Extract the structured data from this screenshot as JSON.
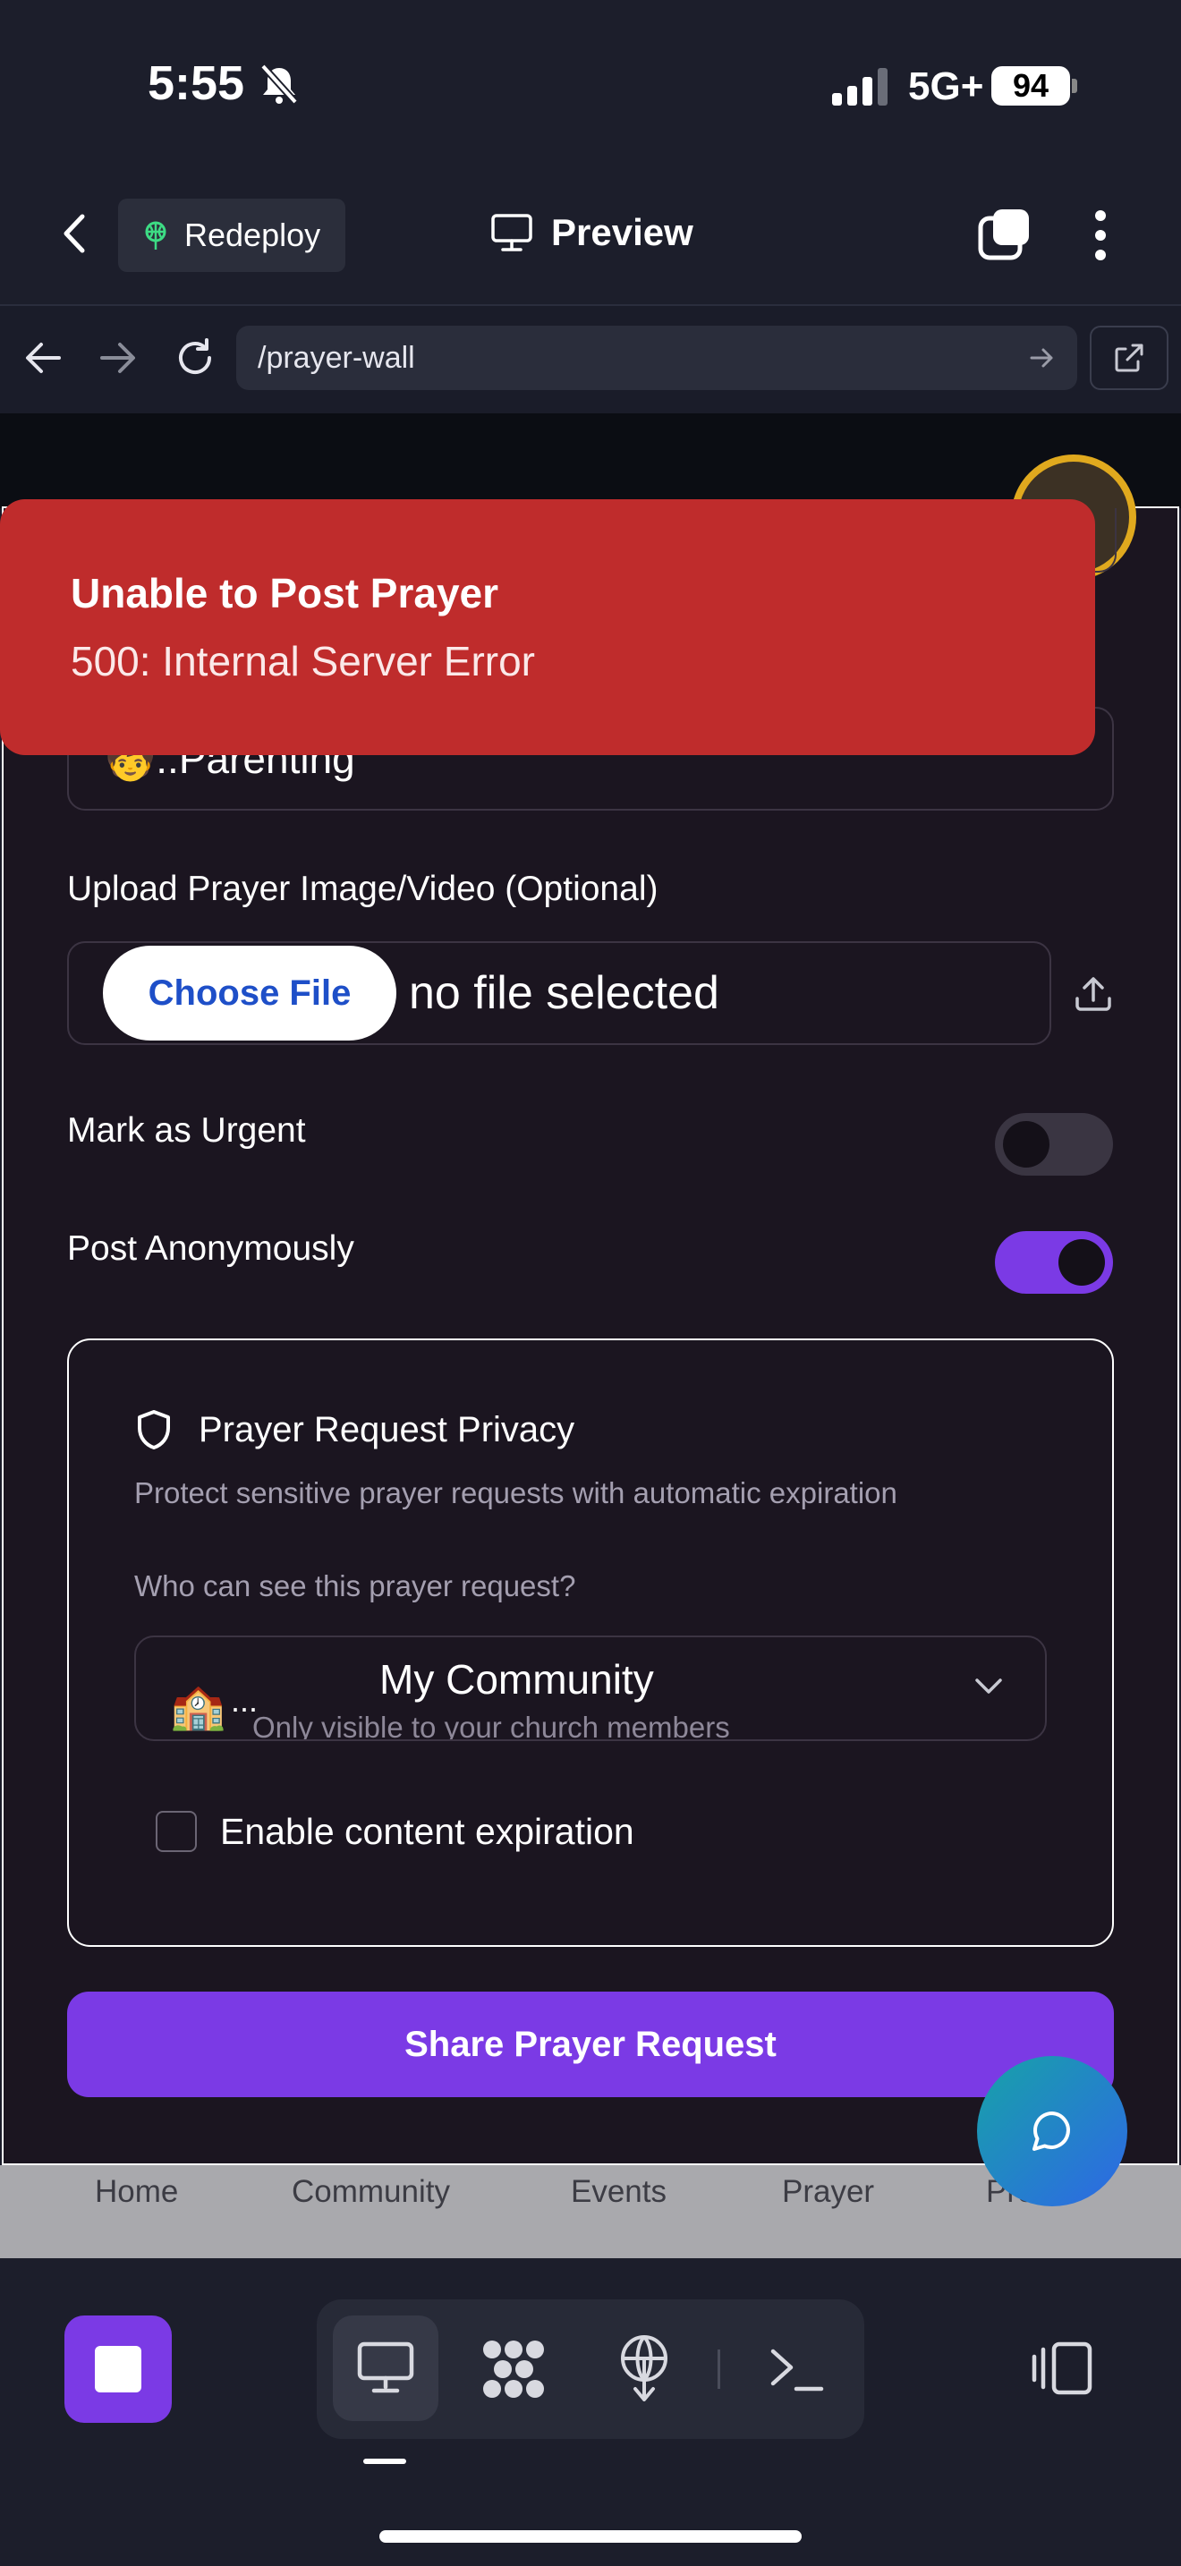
{
  "status_bar": {
    "time": "5:55",
    "network": "5G+",
    "battery": "94"
  },
  "header": {
    "redeploy_label": "Redeploy",
    "preview_label": "Preview"
  },
  "browser": {
    "url": "/prayer-wall"
  },
  "form": {
    "category_value": "🧒..Parenting",
    "upload_label": "Upload Prayer Image/Video (Optional)",
    "choose_file_label": "Choose File",
    "no_file_text": "no file selected",
    "urgent_label": "Mark as Urgent",
    "urgent_on": false,
    "anonymous_label": "Post Anonymously",
    "anonymous_on": true
  },
  "privacy": {
    "title": "Prayer Request Privacy",
    "description": "Protect sensitive prayer requests with automatic expiration",
    "question": "Who can see this prayer request?",
    "selected_icon": "🏫",
    "selected_ellipsis": "...",
    "selected_title": "My Community",
    "selected_desc": "Only visible to your church members",
    "expiration_label": "Enable content expiration"
  },
  "share_button": "Share Prayer Request",
  "bottom_nav": [
    "Home",
    "Community",
    "Events",
    "Prayer",
    "Profile"
  ],
  "toast": {
    "title": "Unable to Post Prayer",
    "message": "500: Internal Server Error"
  },
  "colors": {
    "accent": "#7b3ae5",
    "error": "#bf2c2c",
    "page_bg": "#1b1520",
    "chrome_bg": "#1c1e2b"
  }
}
